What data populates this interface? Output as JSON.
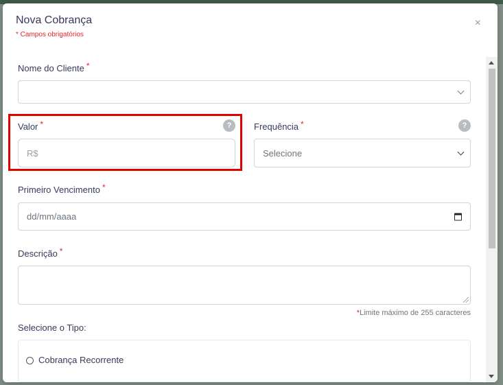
{
  "modal": {
    "title": "Nova Cobrança",
    "required_note": "* Campos obrigatórios",
    "close_label": "×"
  },
  "form": {
    "client": {
      "label": "Nome do Cliente",
      "required_mark": "*",
      "value": ""
    },
    "valor": {
      "label": "Valor",
      "required_mark": "*",
      "placeholder": "R$",
      "help": "?"
    },
    "frequencia": {
      "label": "Frequência",
      "required_mark": "*",
      "selected": "Selecione",
      "help": "?"
    },
    "vencimento": {
      "label": "Primeiro Vencimento",
      "required_mark": "*",
      "placeholder": "dd/mm/aaaa"
    },
    "descricao": {
      "label": "Descrição",
      "required_mark": "*",
      "value": "",
      "limit_mark": "*",
      "limit_note": "Limite máximo de 255 caracteres"
    },
    "tipo": {
      "label": "Selecione o Tipo:",
      "options": [
        {
          "label": "Cobrança Recorrente",
          "checked": false
        }
      ]
    }
  },
  "colors": {
    "required": "#e3242b",
    "highlight": "#e00000",
    "text": "#34395e"
  }
}
